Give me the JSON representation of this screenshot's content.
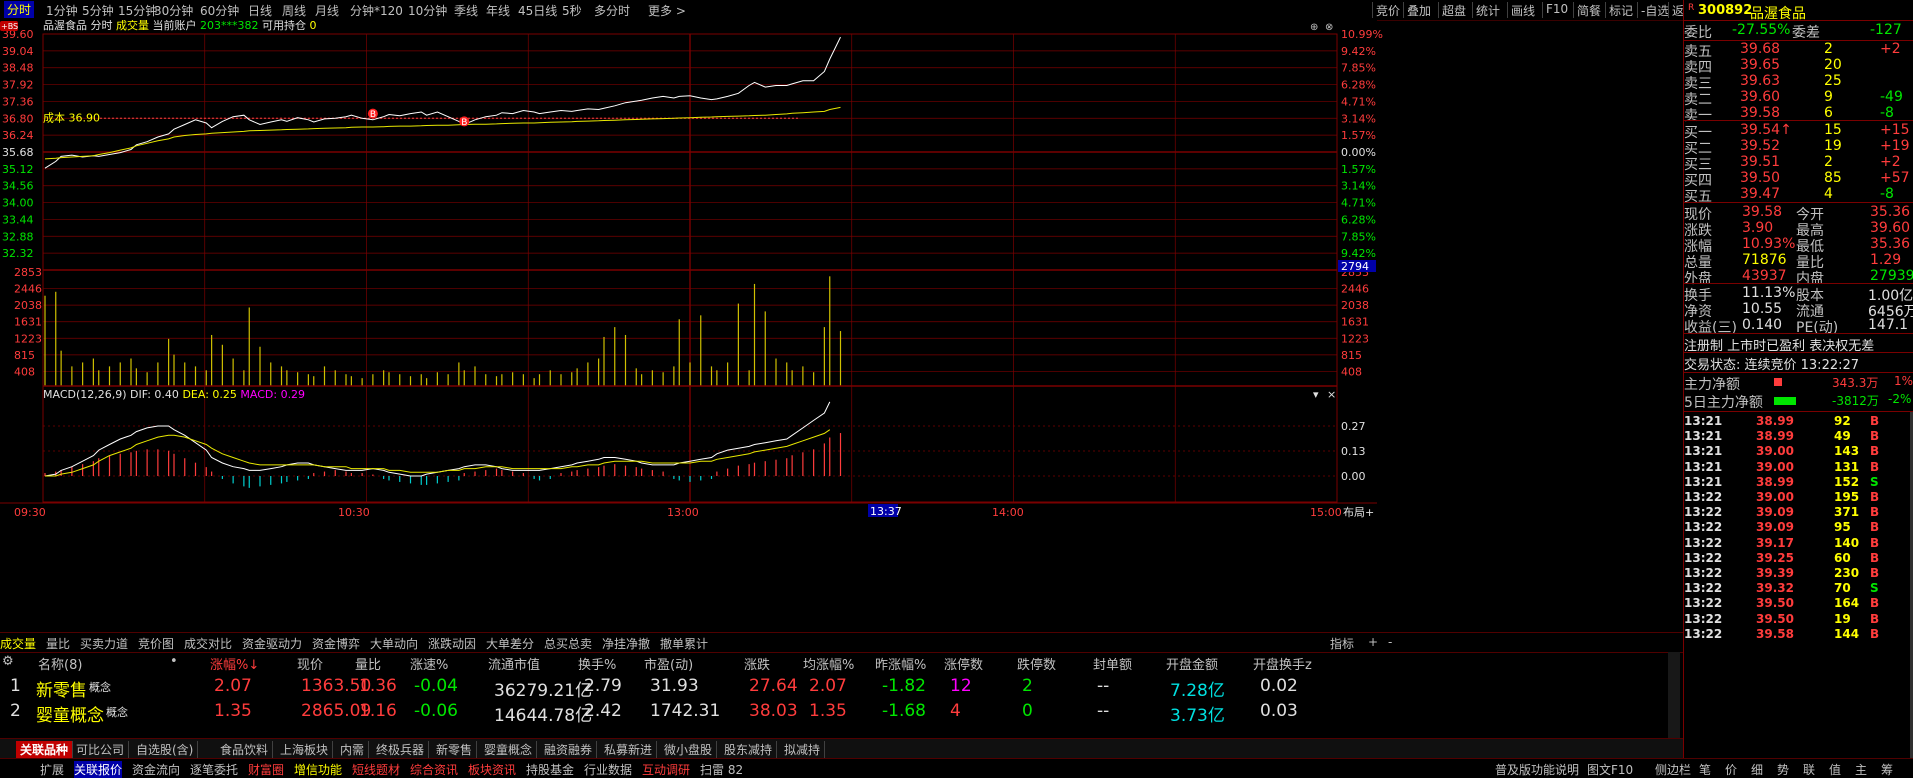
{
  "toolbar": {
    "periods": [
      "分时",
      "1分钟",
      "5分钟",
      "15分钟",
      "30分钟",
      "60分钟",
      "日线",
      "周线",
      "月线",
      "分钟*120",
      "10分钟",
      "季线",
      "年线",
      "45日线",
      "5秒",
      "多分时",
      "更多 >"
    ],
    "tools": [
      "竞价",
      "叠加",
      "超盘",
      "统计",
      "画线",
      "F10",
      "简餐",
      "标记",
      "-自选",
      "返回"
    ]
  },
  "chart_header": {
    "stock_name": "品渥食品",
    "mode": "分时",
    "volume_label": "成交量",
    "account_label": "当前账户",
    "account_id": "203***382",
    "position_label": "可用持仓",
    "position_value": "0",
    "cost_label": "成本 36.90",
    "bs_badge": "+BS"
  },
  "price_axis_left": [
    "39.60",
    "39.04",
    "38.48",
    "37.92",
    "37.36",
    "36.80",
    "36.24",
    "35.68",
    "35.12",
    "34.56",
    "34.00",
    "33.44",
    "32.88",
    "32.32"
  ],
  "pct_axis_right": [
    "10.99%",
    "9.42%",
    "7.85%",
    "6.28%",
    "4.71%",
    "3.14%",
    "1.57%",
    "0.00%",
    "1.57%",
    "3.14%",
    "4.71%",
    "6.28%",
    "7.85%",
    "9.42%"
  ],
  "volume_axis": [
    "2853",
    "2446",
    "2038",
    "1631",
    "1223",
    "815",
    "408"
  ],
  "volume_readout": "2794",
  "macd": {
    "title": "MACD(12,26,9)",
    "dif": "DIF: 0.40",
    "dea": "DEA: 0.25",
    "macd": "MACD: 0.29",
    "axis": [
      "0.27",
      "0.13",
      "0.00"
    ]
  },
  "time_axis": [
    "09:30",
    "10:30",
    "13:00",
    "14:00",
    "15:00"
  ],
  "time_cursor": "13:37",
  "layout_button": "布局+",
  "chart_data": {
    "type": "line",
    "x_range": [
      "09:30",
      "15:00"
    ],
    "price_ylim": [
      32.04,
      39.6
    ],
    "prev_close": 35.68,
    "cost_line": 36.9,
    "series": [
      {
        "name": "price",
        "values": [
          35.3,
          35.52,
          35.68,
          35.72,
          35.66,
          35.7,
          35.68,
          35.74,
          35.8,
          35.9,
          36.05,
          36.15,
          36.3,
          36.4,
          36.55,
          36.7,
          36.85,
          36.75,
          36.6,
          36.8,
          36.95,
          37.0,
          36.85,
          36.7,
          36.78,
          36.85,
          36.8,
          36.92,
          36.85,
          36.78,
          36.88,
          36.9,
          36.95,
          37.0,
          36.9,
          36.85,
          36.95,
          37.02,
          36.98,
          37.05,
          37.1,
          37.0,
          37.1,
          36.95,
          36.8,
          36.7,
          36.85,
          36.95,
          37.0,
          37.08,
          37.05,
          37.15,
          37.1,
          37.05,
          37.1,
          37.15,
          37.12,
          37.15,
          37.2,
          37.18,
          37.22,
          37.3,
          37.4,
          37.45,
          37.48,
          37.55,
          37.6,
          37.55,
          37.6,
          37.62,
          37.55,
          37.5,
          37.52,
          37.6,
          37.7,
          37.95,
          38.05,
          37.9,
          37.95,
          37.95,
          38.0,
          38.1,
          38.1,
          38.4,
          38.8,
          39.5
        ]
      },
      {
        "name": "avg",
        "values": [
          35.6,
          35.62,
          35.64,
          35.66,
          35.68,
          35.7,
          35.74,
          35.8,
          35.88,
          35.95,
          36.02,
          36.1,
          36.18,
          36.24,
          36.3,
          36.35,
          36.38,
          36.4,
          36.42,
          36.44,
          36.46,
          36.48,
          36.5,
          36.51,
          36.52,
          36.53,
          36.54,
          36.55,
          36.56,
          36.57,
          36.58,
          36.59,
          36.6,
          36.61,
          36.62,
          36.62,
          36.63,
          36.64,
          36.65,
          36.65,
          36.66,
          36.67,
          36.68,
          36.68,
          36.69,
          36.7,
          36.71,
          36.71,
          36.72,
          36.73,
          36.74,
          36.75,
          36.75,
          36.76,
          36.77,
          36.78,
          36.79,
          36.8,
          36.81,
          36.82,
          36.83,
          36.84,
          36.85,
          36.86,
          36.87,
          36.88,
          36.89,
          36.9,
          36.91,
          36.92,
          36.93,
          36.94,
          36.95,
          36.96,
          36.97,
          36.98,
          36.99,
          37.0,
          37.02,
          37.04,
          37.06,
          37.08,
          37.1,
          37.12,
          37.18,
          37.25
        ]
      }
    ],
    "volume_ylim": [
      0,
      2853
    ],
    "volume": [
      2300,
      2400,
      900,
      500,
      600,
      700,
      400,
      500,
      600,
      700,
      450,
      350,
      600,
      1200,
      800,
      600,
      500,
      400,
      1300,
      1050,
      700,
      400,
      2000,
      1000,
      600,
      500,
      400,
      350,
      300,
      250,
      500,
      400,
      300,
      250,
      200,
      300,
      400,
      350,
      300,
      250,
      300,
      200,
      350,
      300,
      600,
      400,
      500,
      300,
      250,
      300,
      350,
      300,
      200,
      300,
      400,
      300,
      350,
      450,
      600,
      700,
      1250,
      1500,
      1300,
      450,
      300,
      400,
      350,
      500,
      1700,
      600,
      1800,
      500,
      400,
      600,
      2100,
      400,
      2600,
      1900,
      700,
      600,
      400,
      500,
      350,
      1500,
      2794,
      1400
    ],
    "macd_bars": [
      0.02,
      0.03,
      0.04,
      0.06,
      0.08,
      0.1,
      0.12,
      0.14,
      0.15,
      0.16,
      0.17,
      0.18,
      0.18,
      0.17,
      0.15,
      0.12,
      0.09,
      0.06,
      0.03,
      -0.02,
      -0.05,
      -0.07,
      -0.08,
      -0.07,
      -0.06,
      -0.05,
      -0.04,
      -0.03,
      -0.02,
      0.02,
      0.03,
      0.04,
      0.03,
      0.02,
      0.02,
      0.01,
      -0.02,
      -0.03,
      -0.04,
      -0.05,
      -0.06,
      -0.06,
      -0.05,
      -0.04,
      -0.03,
      0.02,
      0.03,
      0.04,
      0.05,
      0.04,
      0.03,
      0.02,
      -0.02,
      -0.03,
      -0.02,
      0.02,
      0.03,
      0.04,
      0.05,
      0.06,
      0.07,
      0.08,
      0.07,
      0.06,
      0.05,
      0.04,
      0.03,
      -0.02,
      -0.03,
      -0.04,
      -0.03,
      -0.02,
      0.03,
      0.05,
      0.07,
      0.08,
      0.09,
      0.1,
      0.11,
      0.12,
      0.14,
      0.16,
      0.18,
      0.22,
      0.26,
      0.29
    ],
    "dif": [
      0.0,
      0.01,
      0.03,
      0.05,
      0.08,
      0.11,
      0.14,
      0.17,
      0.2,
      0.22,
      0.24,
      0.26,
      0.27,
      0.27,
      0.25,
      0.22,
      0.18,
      0.14,
      0.1,
      0.07,
      0.05,
      0.04,
      0.03,
      0.03,
      0.04,
      0.05,
      0.06,
      0.07,
      0.07,
      0.06,
      0.05,
      0.04,
      0.03,
      0.03,
      0.03,
      0.04,
      0.03,
      0.02,
      0.01,
      0.0,
      0.0,
      0.01,
      0.02,
      0.03,
      0.04,
      0.05,
      0.06,
      0.06,
      0.05,
      0.04,
      0.03,
      0.03,
      0.03,
      0.03,
      0.04,
      0.05,
      0.06,
      0.07,
      0.08,
      0.09,
      0.1,
      0.1,
      0.09,
      0.08,
      0.07,
      0.06,
      0.06,
      0.06,
      0.07,
      0.08,
      0.09,
      0.1,
      0.12,
      0.14,
      0.15,
      0.16,
      0.17,
      0.18,
      0.19,
      0.2,
      0.22,
      0.26,
      0.3,
      0.34,
      0.4
    ],
    "dea": [
      0.0,
      0.0,
      0.01,
      0.02,
      0.04,
      0.06,
      0.08,
      0.11,
      0.13,
      0.15,
      0.17,
      0.19,
      0.21,
      0.22,
      0.22,
      0.21,
      0.19,
      0.17,
      0.15,
      0.12,
      0.1,
      0.08,
      0.07,
      0.06,
      0.06,
      0.06,
      0.06,
      0.06,
      0.06,
      0.06,
      0.05,
      0.05,
      0.05,
      0.04,
      0.04,
      0.04,
      0.04,
      0.03,
      0.03,
      0.02,
      0.02,
      0.02,
      0.02,
      0.03,
      0.03,
      0.04,
      0.04,
      0.05,
      0.05,
      0.05,
      0.04,
      0.04,
      0.04,
      0.04,
      0.04,
      0.04,
      0.05,
      0.05,
      0.06,
      0.06,
      0.07,
      0.08,
      0.08,
      0.08,
      0.08,
      0.07,
      0.07,
      0.07,
      0.07,
      0.07,
      0.08,
      0.08,
      0.09,
      0.1,
      0.11,
      0.12,
      0.13,
      0.14,
      0.15,
      0.16,
      0.17,
      0.19,
      0.21,
      0.23,
      0.25
    ]
  },
  "quote": {
    "code": "300892",
    "name": "品渥食品",
    "weibi_label": "委比",
    "weibi_value": "-27.55%",
    "weicha_label": "委差",
    "weicha_value": "-127",
    "asks": [
      {
        "label": "卖五",
        "price": "39.68",
        "vol": "2",
        "chg": "+2"
      },
      {
        "label": "卖四",
        "price": "39.65",
        "vol": "20",
        "chg": ""
      },
      {
        "label": "卖三",
        "price": "39.63",
        "vol": "25",
        "chg": ""
      },
      {
        "label": "卖二",
        "price": "39.60",
        "vol": "9",
        "chg": "-49"
      },
      {
        "label": "卖一",
        "price": "39.58",
        "vol": "6",
        "chg": "-8"
      }
    ],
    "bids": [
      {
        "label": "买一",
        "price": "39.54↑",
        "vol": "15",
        "chg": "+15"
      },
      {
        "label": "买二",
        "price": "39.52",
        "vol": "19",
        "chg": "+19"
      },
      {
        "label": "买三",
        "price": "39.51",
        "vol": "2",
        "chg": "+2"
      },
      {
        "label": "买四",
        "price": "39.50",
        "vol": "85",
        "chg": "+57"
      },
      {
        "label": "买五",
        "price": "39.47",
        "vol": "4",
        "chg": "-8"
      }
    ],
    "stats": [
      {
        "l1": "现价",
        "v1": "39.58",
        "l2": "今开",
        "v2": "35.36"
      },
      {
        "l1": "涨跌",
        "v1": "3.90",
        "l2": "最高",
        "v2": "39.60"
      },
      {
        "l1": "涨幅",
        "v1": "10.93%",
        "l2": "最低",
        "v2": "35.36"
      },
      {
        "l1": "总量",
        "v1": "71876",
        "l2": "量比",
        "v2": "1.29"
      },
      {
        "l1": "外盘",
        "v1": "43937",
        "l2": "内盘",
        "v2": "27939"
      }
    ],
    "stats2": [
      {
        "l1": "换手",
        "v1": "11.13%",
        "l2": "股本",
        "v2": "1.00亿"
      },
      {
        "l1": "净资",
        "v1": "10.55",
        "l2": "流通",
        "v2": "6456万"
      },
      {
        "l1": "收益(三)",
        "v1": "0.140",
        "l2": "PE(动)",
        "v2": "147.1"
      }
    ],
    "reg_info": "注册制 上市时已盈利 表决权无差",
    "trade_state": "交易状态: 连续竞价 13:22:27",
    "main_net_label": "主力净额",
    "main_net_value": "343.3万",
    "main_net_pct": "1%",
    "main5_label": "5日主力净额",
    "main5_value": "-3812万",
    "main5_pct": "-2%"
  },
  "ticks": [
    {
      "t": "13:21",
      "p": "38.99",
      "v": "92",
      "s": "B"
    },
    {
      "t": "13:21",
      "p": "38.99",
      "v": "49",
      "s": "B"
    },
    {
      "t": "13:21",
      "p": "39.00",
      "v": "143",
      "s": "B"
    },
    {
      "t": "13:21",
      "p": "39.00",
      "v": "131",
      "s": "B"
    },
    {
      "t": "13:21",
      "p": "38.99",
      "v": "152",
      "s": "S"
    },
    {
      "t": "13:22",
      "p": "39.00",
      "v": "195",
      "s": "B"
    },
    {
      "t": "13:22",
      "p": "39.09",
      "v": "371",
      "s": "B"
    },
    {
      "t": "13:22",
      "p": "39.09",
      "v": "95",
      "s": "B"
    },
    {
      "t": "13:22",
      "p": "39.17",
      "v": "140",
      "s": "B"
    },
    {
      "t": "13:22",
      "p": "39.25",
      "v": "60",
      "s": "B"
    },
    {
      "t": "13:22",
      "p": "39.39",
      "v": "230",
      "s": "B"
    },
    {
      "t": "13:22",
      "p": "39.32",
      "v": "70",
      "s": "S"
    },
    {
      "t": "13:22",
      "p": "39.50",
      "v": "164",
      "s": "B"
    },
    {
      "t": "13:22",
      "p": "39.50",
      "v": "19",
      "s": "B"
    },
    {
      "t": "13:22",
      "p": "39.58",
      "v": "144",
      "s": "B"
    }
  ],
  "subtabs": [
    "成交量",
    "量比",
    "买卖力道",
    "竞价图",
    "成交对比",
    "资金驱动力",
    "资金博弈",
    "大单动向",
    "涨跌动因",
    "大单差分",
    "总买总卖",
    "净挂净撤",
    "撤单累计"
  ],
  "subtabs_right": [
    "指标",
    "+",
    "-"
  ],
  "table": {
    "group_label": "名称(8)",
    "headers": [
      "涨幅%↓",
      "现价",
      "量比",
      "涨速%",
      "流通市值",
      "换手%",
      "市盈(动)",
      "涨跌",
      "均涨幅%",
      "昨涨幅%",
      "涨停数",
      "跌停数",
      "封单额",
      "开盘金额",
      "开盘换手z"
    ],
    "rows": [
      {
        "idx": "1",
        "name": "新零售",
        "tag": "概念",
        "cells": [
          "2.07",
          "1363.50",
          "1.36",
          "-0.04",
          "36279.21亿",
          "2.79",
          "31.93",
          "27.64",
          "2.07",
          "-1.82",
          "12",
          "2",
          "--",
          "7.28亿",
          "0.02"
        ]
      },
      {
        "idx": "2",
        "name": "婴童概念",
        "tag": "概念",
        "cells": [
          "1.35",
          "2865.09",
          "1.16",
          "-0.06",
          "14644.78亿",
          "2.42",
          "1742.31",
          "38.03",
          "1.35",
          "-1.68",
          "4",
          "0",
          "--",
          "3.73亿",
          "0.03"
        ]
      }
    ]
  },
  "tabs2": [
    "关联品种",
    "可比公司",
    "自选股(含)",
    "食品饮料",
    "上海板块",
    "内需",
    "终极兵器",
    "新零售",
    "婴童概念",
    "融资融券",
    "私募新进",
    "微小盘股",
    "股东减持",
    "拟减持"
  ],
  "tabs3": [
    "扩展",
    "关联报价",
    "资金流向",
    "逐笔委托",
    "财富圈",
    "增信功能",
    "短线题材",
    "综合资讯",
    "板块资讯",
    "持股基金",
    "行业数据",
    "互动调研",
    "扫雷 82"
  ],
  "tabs3_right": [
    "普及版功能说明",
    "图文F10",
    "侧边栏",
    "笔",
    "价",
    "细",
    "势",
    "联",
    "值",
    "主",
    "筹"
  ]
}
